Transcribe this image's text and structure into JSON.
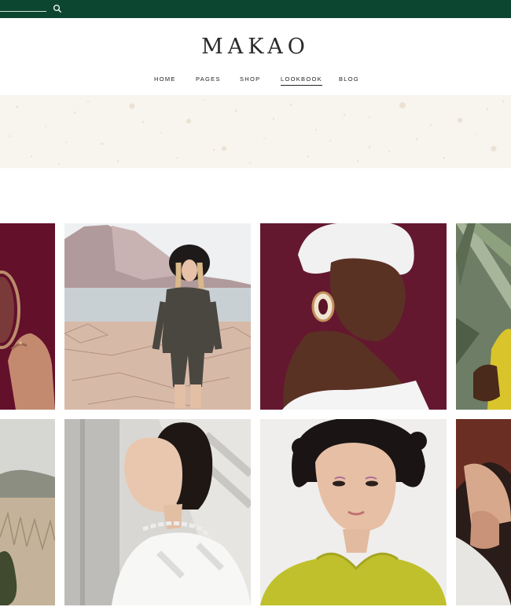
{
  "brand": {
    "name": "MAKAO"
  },
  "header": {
    "search_icon": "search-icon"
  },
  "nav": {
    "items": [
      {
        "label": "HOME"
      },
      {
        "label": "PAGES"
      },
      {
        "label": "SHOP"
      },
      {
        "label": "LOOKBOOK",
        "active": true
      },
      {
        "label": "BLOG"
      }
    ]
  },
  "colors": {
    "topbar": "#0d4630",
    "banner": "#f8f5ef",
    "text": "#222222"
  }
}
